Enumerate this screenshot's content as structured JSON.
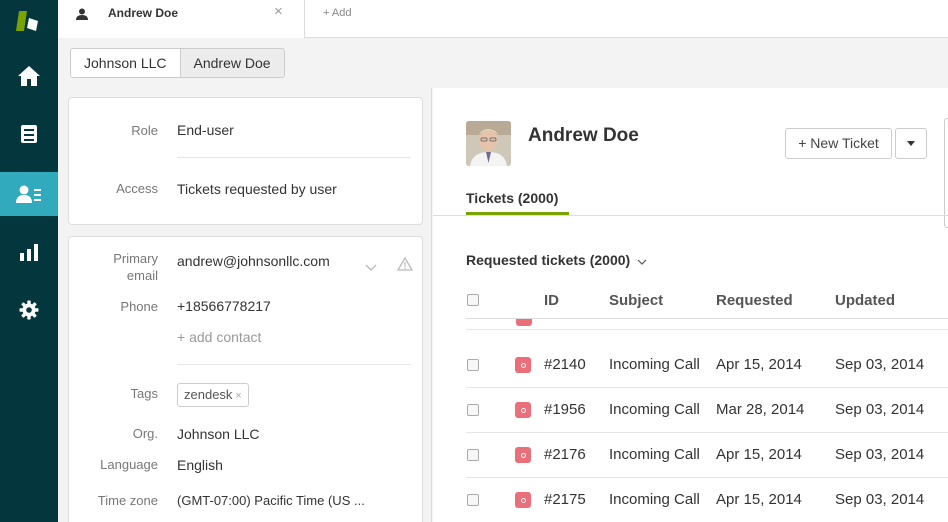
{
  "tabbar": {
    "active_tab_title": "Andrew Doe",
    "close_glyph": "×",
    "add_label": "+ Add"
  },
  "sidebar": {
    "items": [
      {
        "icon": "logo-icon"
      },
      {
        "icon": "home-icon"
      },
      {
        "icon": "views-icon"
      },
      {
        "icon": "customers-icon",
        "active": true
      },
      {
        "icon": "reports-icon"
      },
      {
        "icon": "gear-icon"
      }
    ],
    "active_color": "#30aabc",
    "background": "#03363d"
  },
  "breadcrumb": {
    "org": "Johnson LLC",
    "user": "Andrew Doe"
  },
  "user_card": {
    "role_label": "Role",
    "role_value": "End-user",
    "access_label": "Access",
    "access_value": "Tickets requested by user"
  },
  "contact_card": {
    "primary_email_label_1": "Primary",
    "primary_email_label_2": "email",
    "primary_email_value": "andrew@johnsonllc.com",
    "phone_label": "Phone",
    "phone_value": "+18566778217",
    "add_contact": "+ add contact",
    "tags_label": "Tags",
    "tag": "zendesk",
    "tag_remove": "×",
    "org_label": "Org.",
    "org_value": "Johnson LLC",
    "language_label": "Language",
    "language_value": "English",
    "timezone_label": "Time zone",
    "timezone_value": "(GMT-07:00) Pacific Time (US ..."
  },
  "main": {
    "user_name": "Andrew Doe",
    "new_ticket_label": "+ New Ticket",
    "tickets_tab": "Tickets (2000)",
    "requested_heading": "Requested tickets (2000)",
    "accent_color": "#78a300",
    "columns": {
      "id": "ID",
      "subject": "Subject",
      "requested": "Requested",
      "updated": "Updated"
    },
    "rows": [
      {
        "id": "#2140",
        "subject": "Incoming Call",
        "requested": "Apr 15, 2014",
        "updated": "Sep 03, 2014"
      },
      {
        "id": "#1956",
        "subject": "Incoming Call",
        "requested": "Mar 28, 2014",
        "updated": "Sep 03, 2014"
      },
      {
        "id": "#2176",
        "subject": "Incoming Call",
        "requested": "Apr 15, 2014",
        "updated": "Sep 03, 2014"
      },
      {
        "id": "#2175",
        "subject": "Incoming Call",
        "requested": "Apr 15, 2014",
        "updated": "Sep 03, 2014"
      }
    ],
    "status_color": "#e9707b"
  }
}
